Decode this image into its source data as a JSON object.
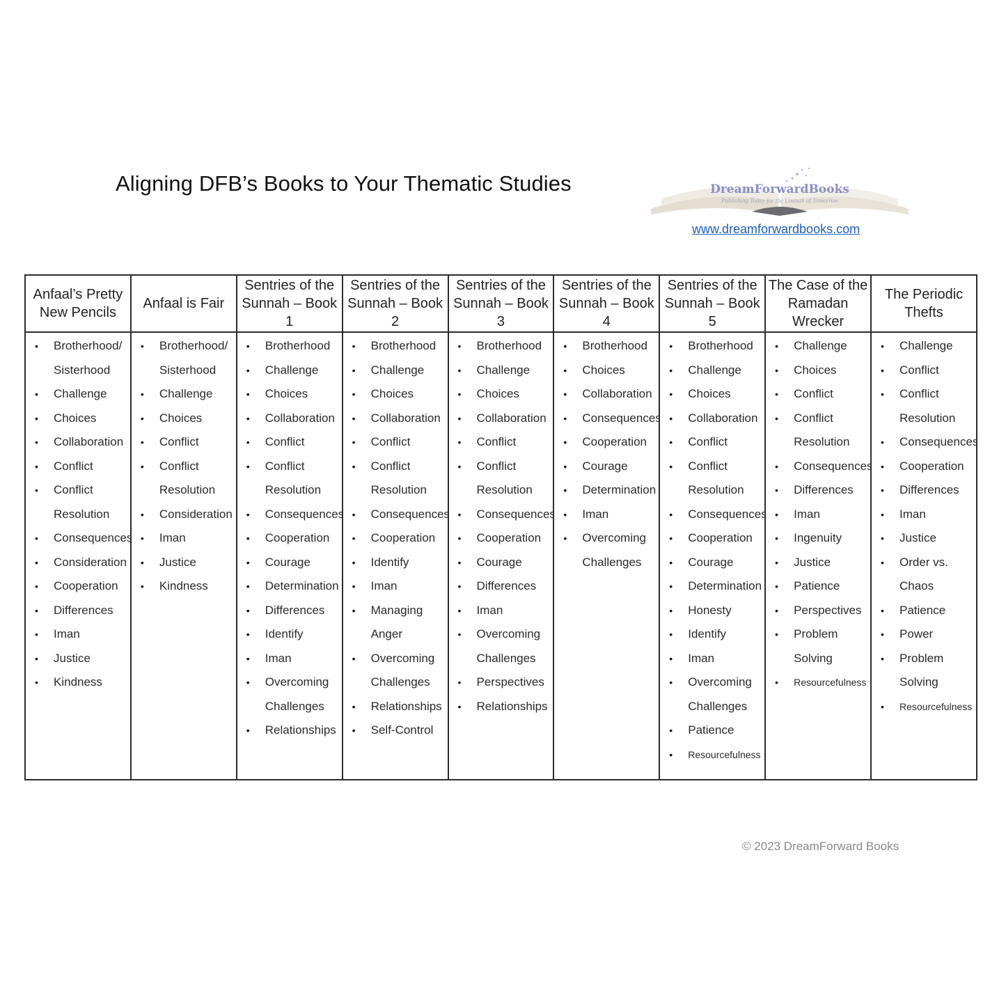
{
  "header": {
    "title": "Aligning DFB’s Books to Your Thematic Studies",
    "logo_name": "DreamForwardBooks",
    "logo_tagline": "Publishing Today for the Ummah of Tomorrow",
    "website": "www.dreamforwardbooks.com"
  },
  "books": [
    {
      "title": "Anfaal’s Pretty New Pencils",
      "themes": [
        "Brotherhood/ Sisterhood",
        "Challenge",
        "Choices",
        "Collaboration",
        "Conflict",
        "Conflict Resolution",
        "Consequences",
        "Consideration",
        "Cooperation",
        "Differences",
        "Iman",
        "Justice",
        "Kindness"
      ]
    },
    {
      "title": "Anfaal is Fair",
      "themes": [
        "Brotherhood/ Sisterhood",
        "Challenge",
        "Choices",
        "Conflict",
        "Conflict Resolution",
        "Consideration",
        "Iman",
        "Justice",
        "Kindness"
      ]
    },
    {
      "title": "Sentries of the Sunnah – Book 1",
      "themes": [
        "Brotherhood",
        "Challenge",
        "Choices",
        "Collaboration",
        "Conflict",
        "Conflict Resolution",
        "Consequences",
        "Cooperation",
        "Courage",
        "Determination",
        "Differences",
        "Identify",
        "Iman",
        "Overcoming Challenges",
        "Relationships"
      ]
    },
    {
      "title": "Sentries of the Sunnah – Book 2",
      "themes": [
        "Brotherhood",
        "Challenge",
        "Choices",
        "Collaboration",
        "Conflict",
        "Conflict Resolution",
        "Consequences",
        "Cooperation",
        "Identify",
        "Iman",
        "Managing Anger",
        "Overcoming Challenges",
        "Relationships",
        "Self-Control"
      ]
    },
    {
      "title": "Sentries of the Sunnah – Book 3",
      "themes": [
        "Brotherhood",
        "Challenge",
        "Choices",
        "Collaboration",
        "Conflict",
        "Conflict Resolution",
        "Consequences",
        "Cooperation",
        "Courage",
        "Differences",
        "Iman",
        "Overcoming Challenges",
        "Perspectives",
        "Relationships"
      ]
    },
    {
      "title": "Sentries of the Sunnah – Book 4",
      "themes": [
        "Brotherhood",
        "Choices",
        "Collaboration",
        "Consequences",
        "Cooperation",
        "Courage",
        "Determination",
        "Iman",
        "Overcoming Challenges"
      ]
    },
    {
      "title": "Sentries of the Sunnah – Book 5",
      "themes": [
        "Brotherhood",
        "Challenge",
        "Choices",
        "Collaboration",
        "Conflict",
        "Conflict Resolution",
        "Consequences",
        "Cooperation",
        "Courage",
        "Determination",
        "Honesty",
        "Identify",
        "Iman",
        "Overcoming Challenges",
        "Patience",
        "Resourcefulness"
      ]
    },
    {
      "title": "The Case of the Ramadan Wrecker",
      "themes": [
        "Challenge",
        "Choices",
        "Conflict",
        "Conflict Resolution",
        "Consequences",
        "Differences",
        "Iman",
        "Ingenuity",
        "Justice",
        "Patience",
        "Perspectives",
        "Problem Solving",
        "Resourcefulness"
      ]
    },
    {
      "title": "The Periodic Thefts",
      "themes": [
        "Challenge",
        "Conflict",
        "Conflict Resolution",
        "Consequences",
        "Cooperation",
        "Differences",
        "Iman",
        "Justice",
        "Order vs. Chaos",
        "Patience",
        "Power",
        "Problem Solving",
        "Resourcefulness"
      ]
    }
  ],
  "footer": {
    "copyright": "© 2023 DreamForward Books"
  }
}
